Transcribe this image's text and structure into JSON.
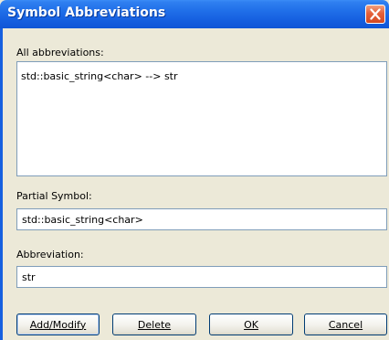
{
  "window": {
    "title": "Symbol Abbreviations",
    "close_icon": "close-icon",
    "titlebar_color": "#1660e0",
    "close_color": "#e5603a"
  },
  "abbreviations": {
    "label": "All abbreviations:",
    "items": [
      "std::basic_string<char> --> str"
    ]
  },
  "partial_symbol": {
    "label": "Partial Symbol:",
    "value": "std::basic_string<char>"
  },
  "abbreviation": {
    "label": "Abbreviation:",
    "value": "str"
  },
  "buttons": {
    "add_modify": "Add/Modify",
    "delete": "Delete",
    "ok": "OK",
    "cancel": "Cancel"
  }
}
